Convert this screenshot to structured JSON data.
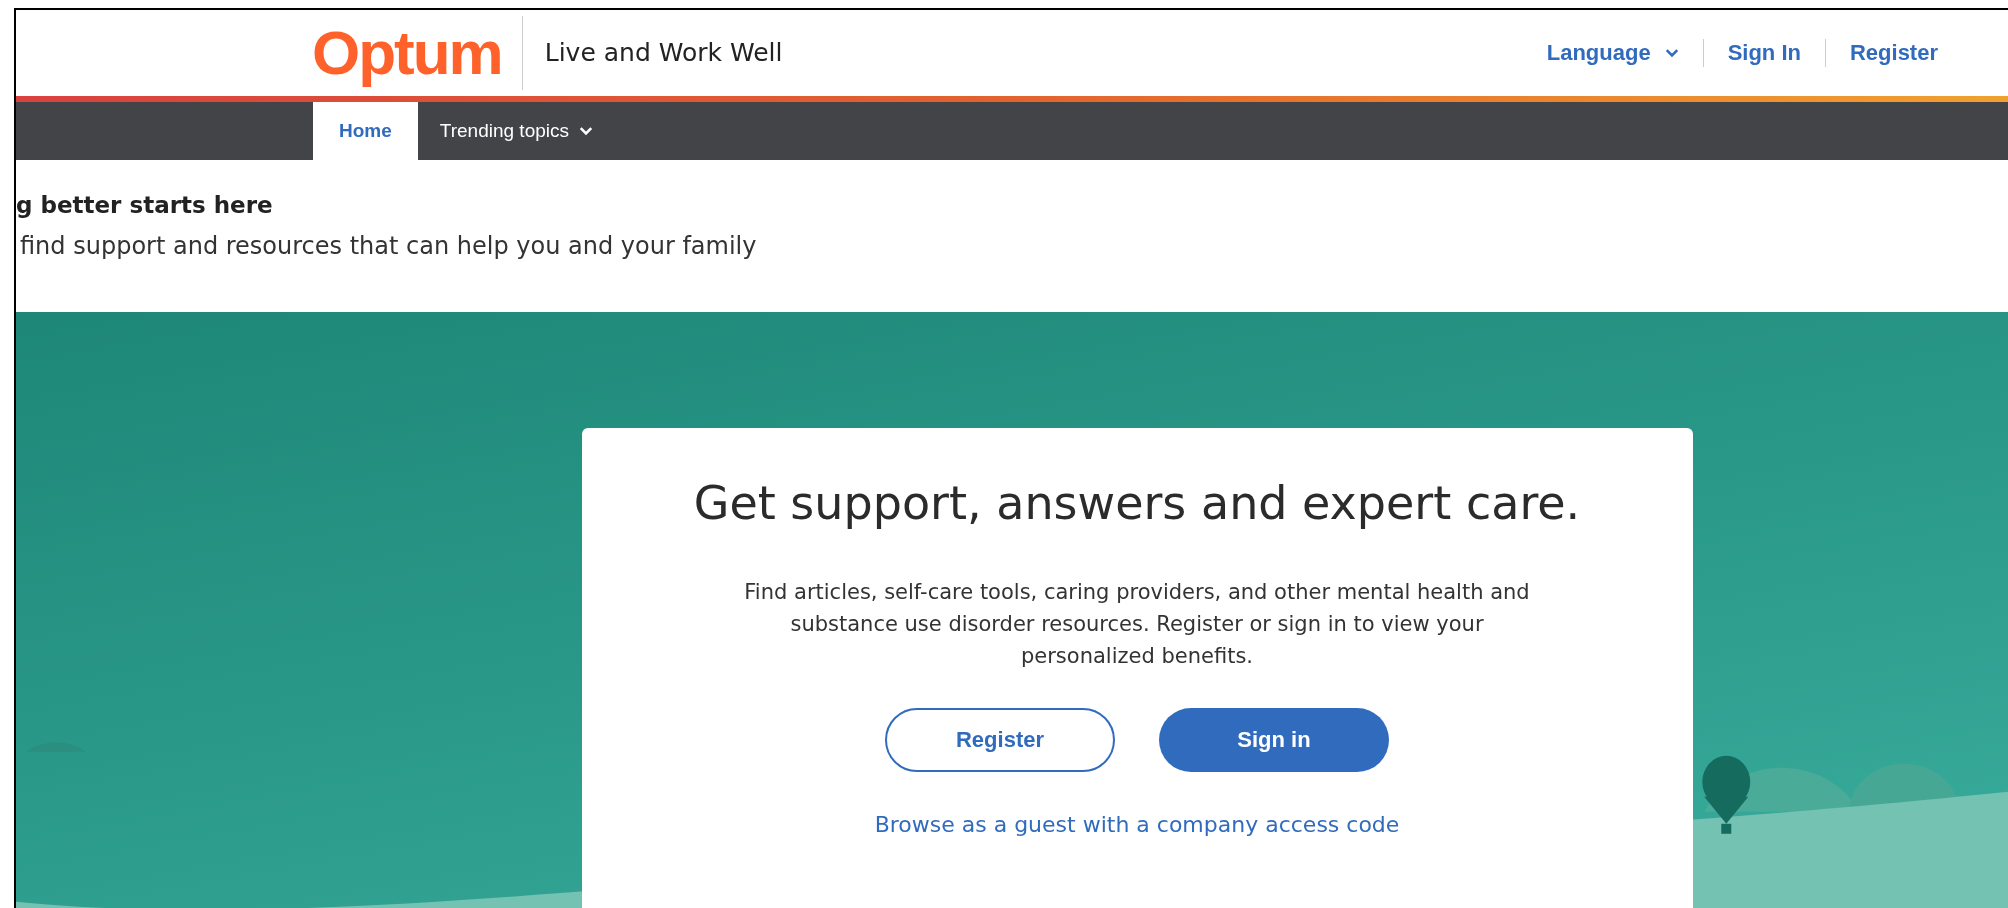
{
  "header": {
    "logo": "Optum",
    "tagline": "Live and Work Well",
    "links": [
      {
        "label": "Language",
        "kind": "dropdown"
      },
      {
        "label": "Sign In",
        "kind": "link"
      },
      {
        "label": "Register",
        "kind": "link"
      }
    ]
  },
  "nav": {
    "tabs": [
      {
        "label": "Home",
        "selected": true,
        "kind": "link"
      },
      {
        "label": "Trending topics",
        "selected": false,
        "kind": "dropdown"
      }
    ]
  },
  "intro": {
    "heading": "g better starts here",
    "subtitle": "find support and resources that can help you and your family"
  },
  "card": {
    "heading": "Get support, answers and expert care.",
    "body": "Find articles, self-care tools, caring providers, and other mental health and substance use disorder resources. Register or sign in to view your personalized benefits.",
    "buttons": [
      {
        "label": "Register",
        "kind": "outline"
      },
      {
        "label": "Sign in",
        "kind": "primary"
      }
    ],
    "link": "Browse as a guest with a company access code"
  }
}
